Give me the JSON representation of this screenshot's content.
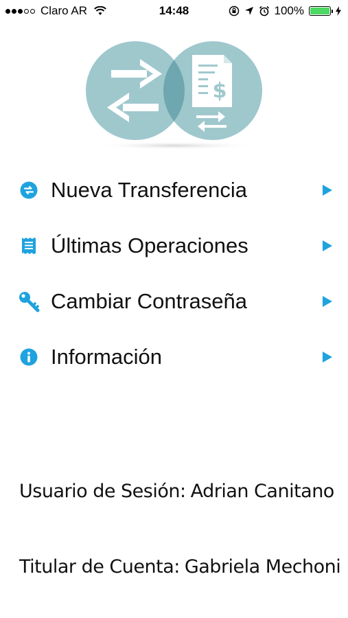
{
  "status_bar": {
    "carrier": "Claro AR",
    "time": "14:48",
    "battery": "100%",
    "icons": [
      "signal-dots-icon",
      "wifi-icon",
      "orientation-lock-icon",
      "location-arrow-icon",
      "alarm-icon",
      "battery-icon",
      "charging-bolt-icon"
    ]
  },
  "logo": {
    "name": "transfer-logo",
    "colors": {
      "circle": "#9fc8cd",
      "overlap": "#6ea7b0",
      "glyph": "#ffffff"
    }
  },
  "menu": {
    "accent": "#1fa3de",
    "items": [
      {
        "label": "Nueva Transferencia",
        "icon": "transfer-arrows-icon"
      },
      {
        "label": "Últimas Operaciones",
        "icon": "receipt-icon"
      },
      {
        "label": "Cambiar Contraseña",
        "icon": "key-icon"
      },
      {
        "label": "Información",
        "icon": "info-icon"
      }
    ]
  },
  "footer": {
    "session_label": "Usuario de Sesión:",
    "session_value": "Adrian Canitano",
    "holder_label": "Titular de Cuenta:",
    "holder_value": "Gabriela Mechoni"
  }
}
